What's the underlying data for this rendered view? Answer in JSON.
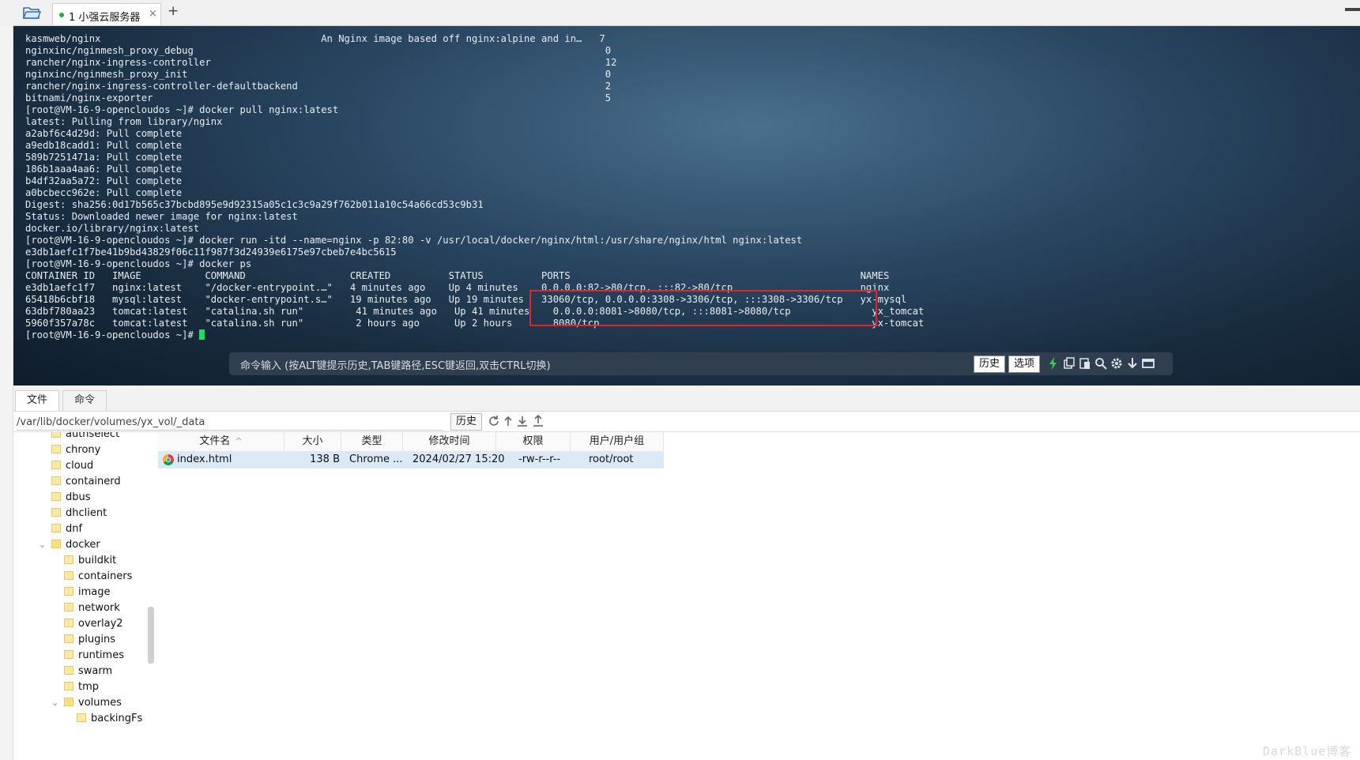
{
  "tabs": {
    "session_label": "1 小强云服务器",
    "close": "×",
    "add": "+"
  },
  "terminal": {
    "lines": [
      "kasmweb/nginx                                      An Nginx image based off nginx:alpine and in…   7",
      "nginxinc/nginmesh_proxy_debug                                                                       0",
      "rancher/nginx-ingress-controller                                                                    12",
      "nginxinc/nginmesh_proxy_init                                                                        0",
      "rancher/nginx-ingress-controller-defaultbackend                                                     2",
      "bitnami/nginx-exporter                                                                              5",
      "[root@VM-16-9-opencloudos ~]# docker pull nginx:latest",
      "latest: Pulling from library/nginx",
      "a2abf6c4d29d: Pull complete",
      "a9edb18cadd1: Pull complete",
      "589b7251471a: Pull complete",
      "186b1aaa4aa6: Pull complete",
      "b4df32aa5a72: Pull complete",
      "a0bcbecc962e: Pull complete",
      "Digest: sha256:0d17b565c37bcbd895e9d92315a05c1c3c9a29f762b011a10c54a66cd53c9b31",
      "Status: Downloaded newer image for nginx:latest",
      "docker.io/library/nginx:latest",
      "[root@VM-16-9-opencloudos ~]# docker run -itd --name=nginx -p 82:80 -v /usr/local/docker/nginx/html:/usr/share/nginx/html nginx:latest",
      "e3db1aefc1f7be41b9bd43829f06c11f987f3d24939e6175e97cbeb7e4bc5615",
      "[root@VM-16-9-opencloudos ~]# docker ps",
      "CONTAINER ID   IMAGE           COMMAND                  CREATED          STATUS          PORTS                                                  NAMES",
      "e3db1aefc1f7   nginx:latest    \"/docker-entrypoint.…\"   4 minutes ago    Up 4 minutes    0.0.0.0:82->80/tcp, :::82->80/tcp                      nginx",
      "65418b6cbf18   mysql:latest    \"docker-entrypoint.s…\"   19 minutes ago   Up 19 minutes   33060/tcp, 0.0.0.0:3308->3306/tcp, :::3308->3306/tcp   yx-mysql",
      "63dbf780aa23   tomcat:latest   \"catalina.sh run\"         41 minutes ago   Up 41 minutes    0.0.0.0:8081->8080/tcp, :::8081->8080/tcp              yx_tomcat",
      "5960f357a78c   tomcat:latest   \"catalina.sh run\"         2 hours ago      Up 2 hours       8080/tcp                                               yx-tomcat"
    ],
    "prompt": "[root@VM-16-9-opencloudos ~]# "
  },
  "cmdbar": {
    "hint": "命令输入 (按ALT键提示历史,TAB键路径,ESC键返回,双击CTRL切换)",
    "history_btn": "历史",
    "options_btn": "选项"
  },
  "filebrowser": {
    "tab_files": "文件",
    "tab_commands": "命令",
    "path": "/var/lib/docker/volumes/yx_vol/_data",
    "history_btn": "历史",
    "tree": [
      {
        "label": "authselect",
        "level": 1
      },
      {
        "label": "chrony",
        "level": 1
      },
      {
        "label": "cloud",
        "level": 1
      },
      {
        "label": "containerd",
        "level": 1
      },
      {
        "label": "dbus",
        "level": 1
      },
      {
        "label": "dhclient",
        "level": 1
      },
      {
        "label": "dnf",
        "level": 1
      },
      {
        "label": "docker",
        "level": 1,
        "expanded": true
      },
      {
        "label": "buildkit",
        "level": 2
      },
      {
        "label": "containers",
        "level": 2
      },
      {
        "label": "image",
        "level": 2
      },
      {
        "label": "network",
        "level": 2
      },
      {
        "label": "overlay2",
        "level": 2
      },
      {
        "label": "plugins",
        "level": 2
      },
      {
        "label": "runtimes",
        "level": 2
      },
      {
        "label": "swarm",
        "level": 2
      },
      {
        "label": "tmp",
        "level": 2
      },
      {
        "label": "volumes",
        "level": 2,
        "expanded": true
      },
      {
        "label": "backingFs",
        "level": 3
      }
    ],
    "columns": [
      "文件名",
      "大小",
      "类型",
      "修改时间",
      "权限",
      "用户/用户组"
    ],
    "sort_indicator": "^",
    "rows": [
      {
        "name": "index.html",
        "size": "138 B",
        "type": "Chrome ...",
        "modified": "2024/02/27 15:20",
        "perms": "-rw-r--r--",
        "owner": "root/root"
      }
    ]
  },
  "watermark": "DarkBlue博客",
  "colors": {
    "highlight": "#e0262a",
    "cursor": "#19e05a",
    "row_selected": "#dbe8f5",
    "cmdbar": "#2f3f50"
  }
}
